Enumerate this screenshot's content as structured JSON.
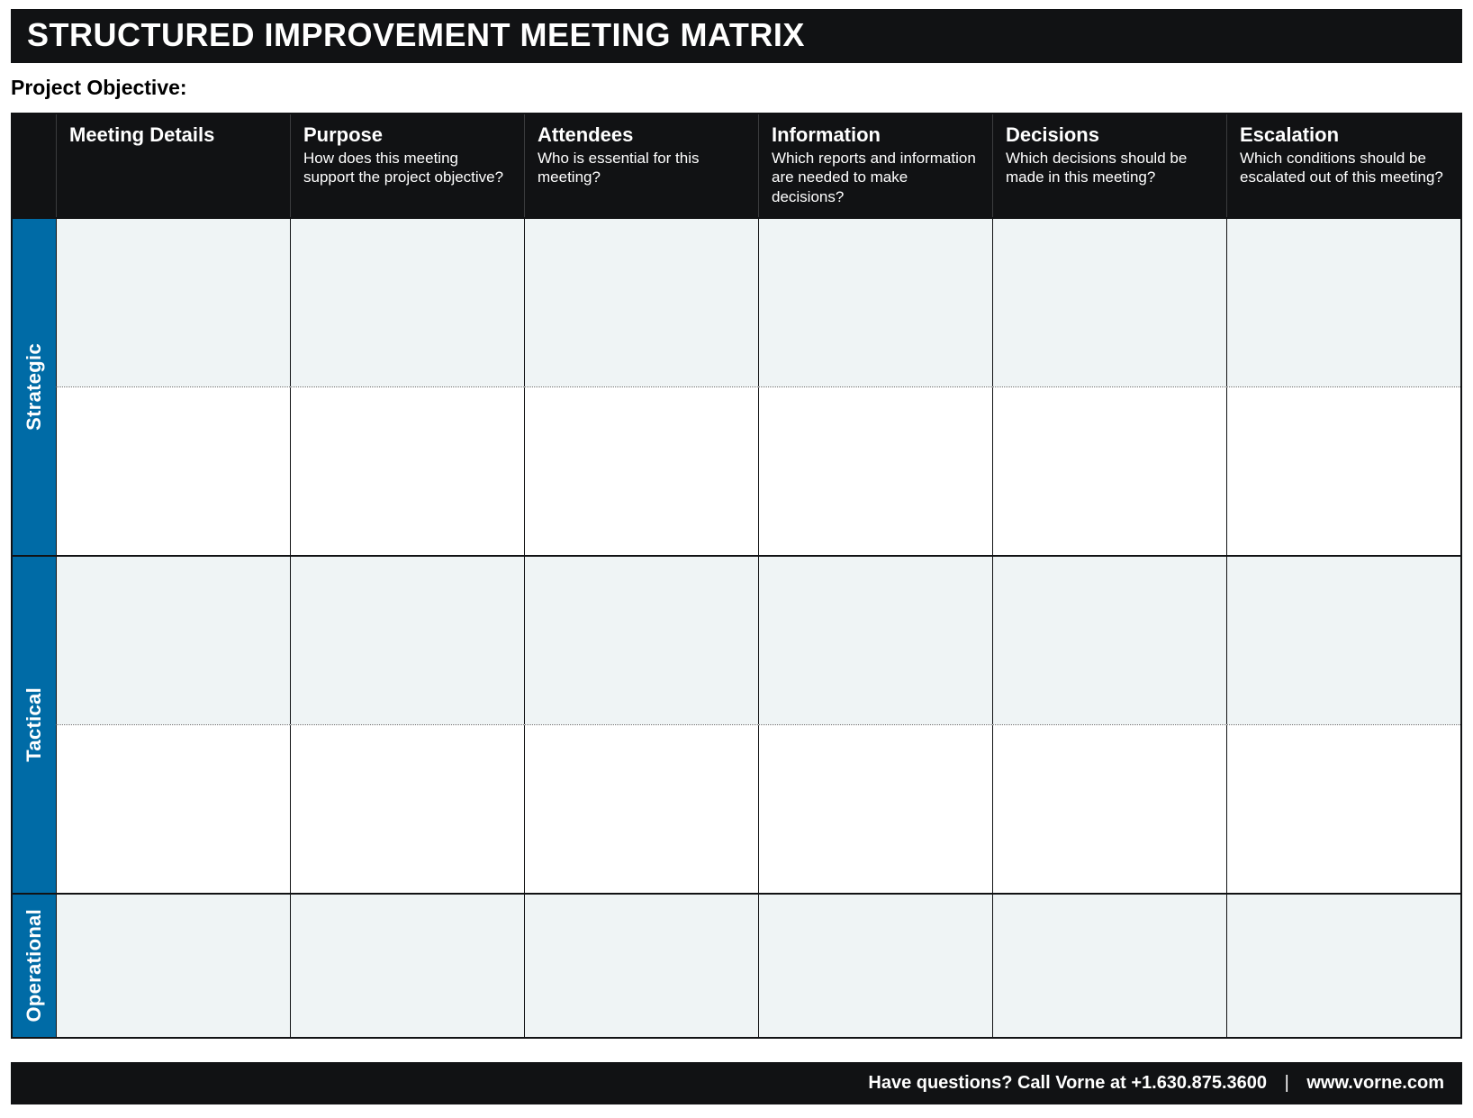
{
  "banner": {
    "title": "STRUCTURED IMPROVEMENT MEETING MATRIX"
  },
  "objective": {
    "label": "Project Objective:"
  },
  "columns": [
    {
      "title": "Meeting Details",
      "sub": ""
    },
    {
      "title": "Purpose",
      "sub": "How does this meeting support the project objective?"
    },
    {
      "title": "Attendees",
      "sub": "Who is essential for this meeting?"
    },
    {
      "title": "Information",
      "sub": "Which reports and information are needed to make decisions?"
    },
    {
      "title": "Decisions",
      "sub": "Which decisions should be made in this meeting?"
    },
    {
      "title": "Escalation",
      "sub": "Which conditions should be escalated out of this meeting?"
    }
  ],
  "sections": {
    "strategic": {
      "label": "Strategic"
    },
    "tactical": {
      "label": "Tactical"
    },
    "operational": {
      "label": "Operational"
    }
  },
  "footer": {
    "lead": "Have questions? ",
    "call": "Call Vorne at",
    "phone": "+1.630.875.3600",
    "site": "www.vorne.com"
  }
}
